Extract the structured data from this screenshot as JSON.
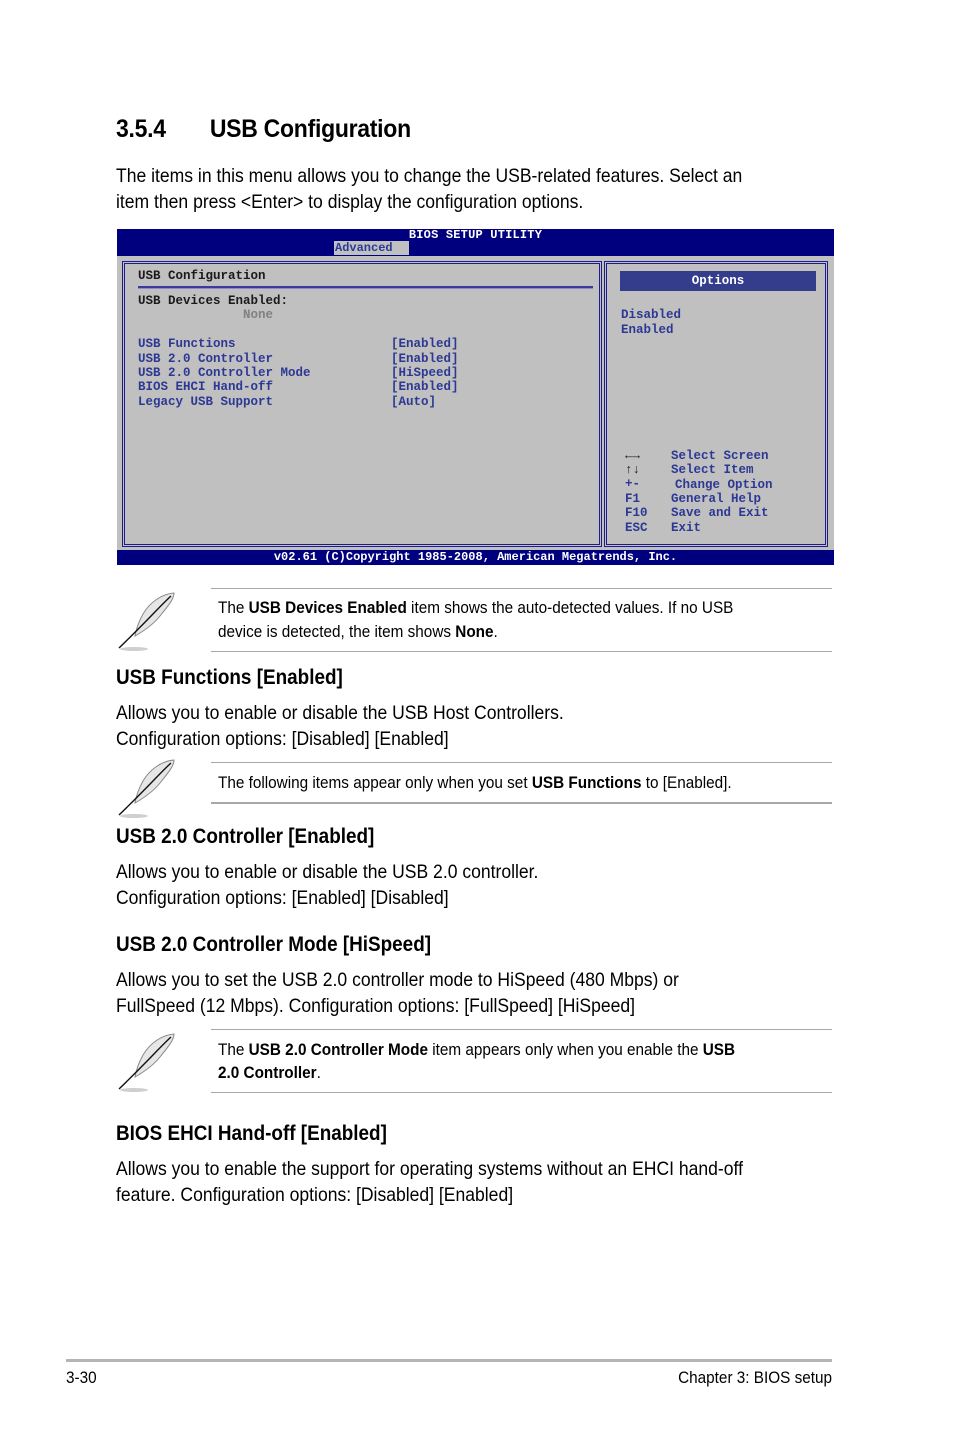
{
  "section": {
    "number": "3.5.4",
    "title": "USB Configuration",
    "intro": [
      "The items in this menu allows you to change the USB-related features. Select an",
      "item then press <Enter> to display the configuration options."
    ]
  },
  "bios": {
    "title": "BIOS SETUP UTILITY",
    "active_tab": "Advanced",
    "panel_title": "USB Configuration",
    "devices_label": "USB Devices Enabled:",
    "devices_value": "None",
    "items": [
      {
        "label": "USB Functions",
        "value": "[Enabled]"
      },
      {
        "label": "USB 2.0 Controller",
        "value": "[Enabled]"
      },
      {
        "label": "USB 2.0 Controller Mode",
        "value": "[HiSpeed]"
      },
      {
        "label": "BIOS EHCI Hand-off",
        "value": "[Enabled]"
      },
      {
        "label": "Legacy USB Support",
        "value": "[Auto]"
      }
    ],
    "options_header": "Options",
    "options": [
      "Disabled",
      "Enabled"
    ],
    "help": [
      {
        "key": "←→",
        "icon": "left-right-arrows-icon",
        "text": "Select Screen"
      },
      {
        "key": "↑↓",
        "icon": "up-down-arrows-icon",
        "text": "Select Item"
      },
      {
        "key": "+-",
        "icon": "plus-minus-icon",
        "text": "Change Option"
      },
      {
        "key": "F1",
        "text": "General Help"
      },
      {
        "key": "F10",
        "text": "Save and Exit"
      },
      {
        "key": "ESC",
        "text": "Exit"
      }
    ],
    "footer": "v02.61 (C)Copyright 1985-2008, American Megatrends, Inc."
  },
  "notes": [
    {
      "icon": "feather-note-icon",
      "line1": [
        {
          "t": "The ",
          "b": false
        },
        {
          "t": "USB Devices Enabled",
          "b": true
        },
        {
          "t": " item shows the auto-detected values. If no USB",
          "b": false
        }
      ],
      "line2": [
        {
          "t": "device is detected, the item shows ",
          "b": false
        },
        {
          "t": "None",
          "b": true
        },
        {
          "t": ".",
          "b": false
        }
      ]
    },
    {
      "icon": "feather-note-icon",
      "line1": [
        {
          "t": "The following items appear only when you set ",
          "b": false
        },
        {
          "t": "USB Functions",
          "b": true
        },
        {
          "t": " to [Enabled].",
          "b": false
        }
      ]
    },
    {
      "icon": "feather-note-icon",
      "line1": [
        {
          "t": "The ",
          "b": false
        },
        {
          "t": "USB 2.0 Controller Mode",
          "b": true
        },
        {
          "t": " item appears only when you enable the ",
          "b": false
        },
        {
          "t": "USB",
          "b": true
        }
      ],
      "line2": [
        {
          "t": "2.0 Controller",
          "b": true
        },
        {
          "t": ".",
          "b": false
        }
      ]
    }
  ],
  "subsections": [
    {
      "heading": "USB Functions [Enabled]",
      "body": [
        "Allows you to enable or disable the USB Host Controllers.",
        "Configuration options: [Disabled] [Enabled]"
      ]
    },
    {
      "heading": "USB 2.0 Controller [Enabled]",
      "body": [
        "Allows you to enable or disable the USB 2.0 controller.",
        "Configuration options: [Enabled] [Disabled]"
      ]
    },
    {
      "heading": "USB 2.0 Controller Mode [HiSpeed]",
      "body": [
        "Allows you to set the USB 2.0 controller mode to HiSpeed (480 Mbps) or",
        "FullSpeed (12 Mbps). Configuration options: [FullSpeed] [HiSpeed]"
      ]
    },
    {
      "heading": "BIOS EHCI Hand-off [Enabled]",
      "body": [
        "Allows you to enable the support for operating systems without an EHCI hand-off",
        "feature. Configuration options: [Disabled] [Enabled]"
      ]
    }
  ],
  "footer": {
    "page_number": "3-30",
    "chapter": "Chapter 3: BIOS setup"
  }
}
